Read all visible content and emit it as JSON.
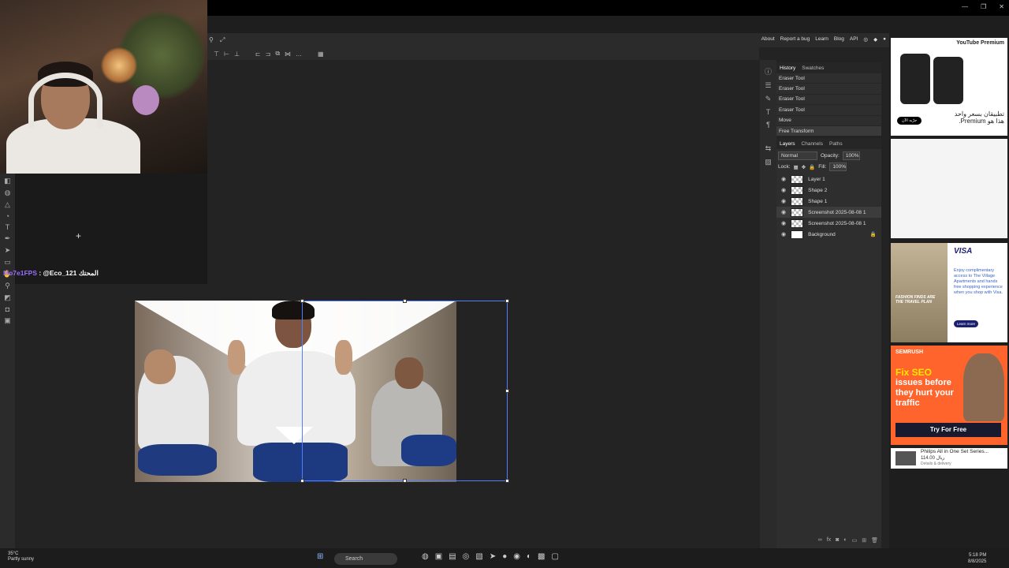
{
  "photopea": {
    "links": [
      "About",
      "Report a bug",
      "Learn",
      "Blog",
      "API"
    ],
    "history": {
      "tabs": [
        "History",
        "Swatches"
      ],
      "items": [
        "Eraser Tool",
        "Eraser Tool",
        "Eraser Tool",
        "Eraser Tool",
        "Move",
        "Free Transform"
      ]
    },
    "layers": {
      "tabs": [
        "Layers",
        "Channels",
        "Paths"
      ],
      "blend_mode": "Normal",
      "opacity_label": "Opacity:",
      "opacity_value": "100%",
      "lock_label": "Lock:",
      "fill_label": "Fill:",
      "fill_value": "100%",
      "items": [
        "Layer 1",
        "Shape 2",
        "Shape 1",
        "Screenshot 2025-08-08 1",
        "Screenshot 2025-08-08 1",
        "Background"
      ]
    }
  },
  "chat": {
    "username": "Mo7e1FPS",
    "message": ": @Eco_121 المحتك"
  },
  "ads": {
    "youtube_brand": "YouTube Premium",
    "youtube_text": "تطبيقان بسعر واحد هذا هو Premium.",
    "youtube_cta": "جرّبه الآن",
    "visa_brand": "VISA",
    "visa_text": "Enjoy complimentary access to The Village Apartments and hands free shopping experience when you shop with Visa.",
    "visa_cta": "Learn more",
    "visa_image_text": "FASHION FINDS ARE THE TRAVEL PLAN",
    "semrush_brand": "SEMRUSH",
    "semrush_headline_1": "Fix SEO",
    "semrush_headline_2": "issues before they hurt your traffic",
    "semrush_cta": "Try For Free",
    "philips_title": "Philips All in One Set Series...",
    "philips_price": "114.00 ريال",
    "philips_sub": "Details & delivery"
  },
  "taskbar": {
    "weather_temp": "35°C",
    "weather_desc": "Partly sunny",
    "search_label": "Search",
    "time": "5:18 PM",
    "date": "8/8/2025"
  },
  "colors": {
    "accent_selection": "#4f7fff",
    "chat_username": "#9b6cff",
    "semrush_orange": "#ff642d"
  }
}
